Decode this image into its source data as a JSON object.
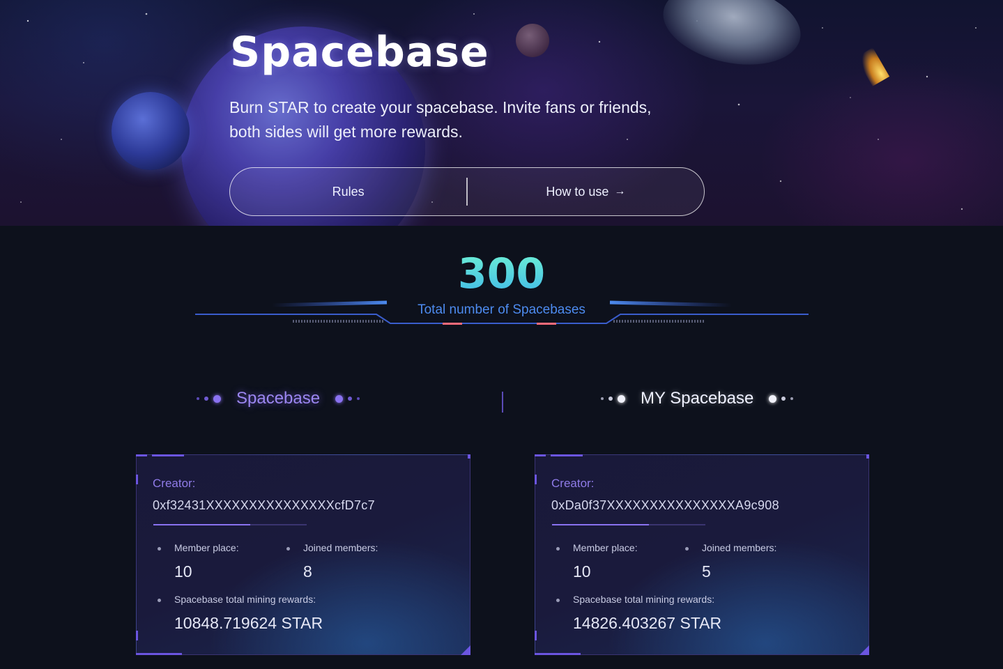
{
  "hero": {
    "title": "Spacebase",
    "description_line1": "Burn STAR to create your spacebase. Invite fans or friends,",
    "description_line2": "both sides will get more rewards.",
    "rules_label": "Rules",
    "how_to_use_label": "How to use",
    "how_to_use_icon": "arrow-right-icon"
  },
  "stats": {
    "total_value": "300",
    "total_label": "Total number of Spacebases"
  },
  "tabs": [
    {
      "label": "Spacebase",
      "active": true
    },
    {
      "label": "MY Spacebase",
      "active": false
    }
  ],
  "cards": [
    {
      "creator_label": "Creator:",
      "creator_address": "0xf32431XXXXXXXXXXXXXXXcfD7c7",
      "member_place_label": "Member place:",
      "member_place_value": "10",
      "joined_members_label": "Joined members:",
      "joined_members_value": "8",
      "rewards_label": "Spacebase total mining rewards:",
      "rewards_value": "10848.719624 STAR"
    },
    {
      "creator_label": "Creator:",
      "creator_address": "0xDa0f37XXXXXXXXXXXXXXXA9c908",
      "member_place_label": "Member place:",
      "member_place_value": "10",
      "joined_members_label": "Joined members:",
      "joined_members_value": "5",
      "rewards_label": "Spacebase total mining rewards:",
      "rewards_value": "14826.403267 STAR"
    }
  ],
  "colors": {
    "accent": "#8a72f0",
    "background": "#0d111c",
    "counter_top": "#6ff2d4",
    "counter_bottom": "#3fb7e8",
    "label_blue": "#4d8bef"
  }
}
